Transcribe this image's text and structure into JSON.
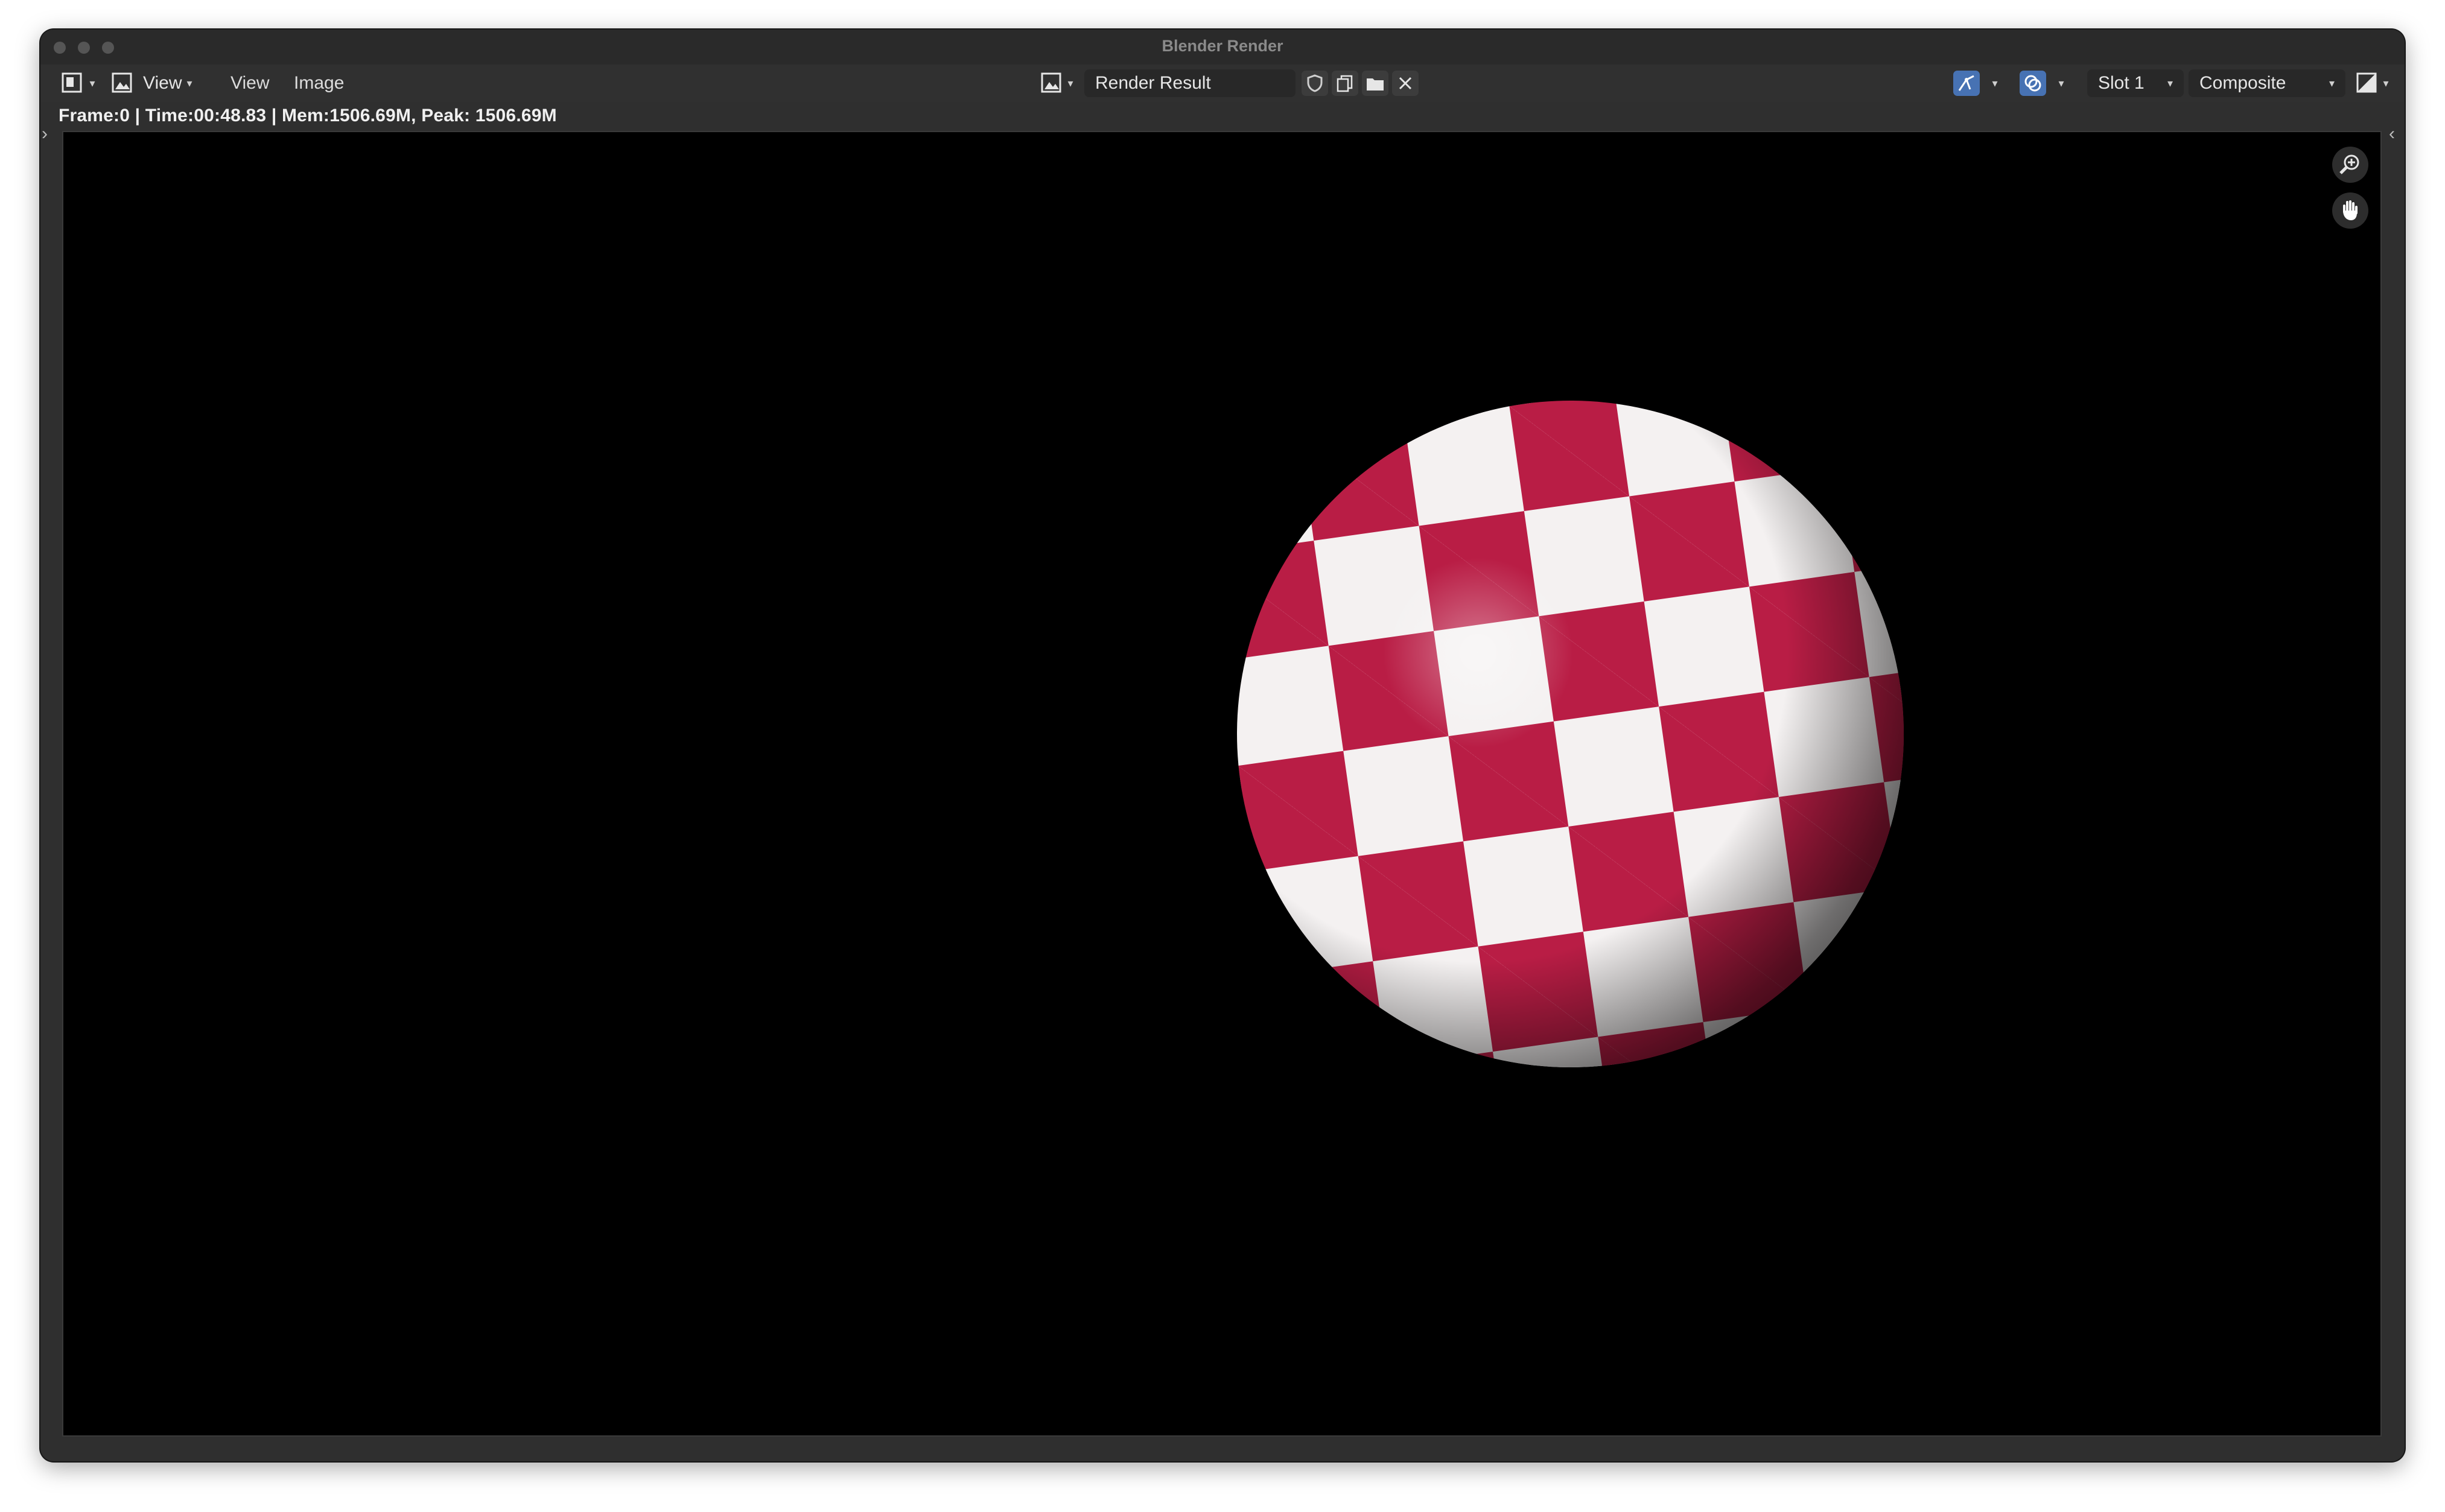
{
  "window": {
    "title": "Blender Render"
  },
  "header": {
    "editor_type_icon": "image-editor-icon",
    "view_mode_label": "View",
    "menus": [
      "View",
      "Image"
    ],
    "image_browse_icon": "image-browse-icon",
    "image_name": "Render Result",
    "image_actions": [
      "shield-icon",
      "duplicate-icon",
      "open-folder-icon",
      "close-icon"
    ],
    "gizmo_icon": "gizmo-icon",
    "overlay_icon": "overlay-icon",
    "slot": "Slot 1",
    "layer": "Composite",
    "display_channels_icon": "display-channels-icon"
  },
  "status_line": "Frame:0 | Time:00:48.83 | Mem:1506.69M, Peak: 1506.69M",
  "render": {
    "background": "#000000",
    "checker_colors": [
      "#b91d45",
      "#f4f1f1"
    ]
  },
  "viewport_tools": [
    "zoom-icon",
    "pan-hand-icon"
  ],
  "colors": {
    "accent": "#4772b3",
    "panel": "#303030"
  }
}
